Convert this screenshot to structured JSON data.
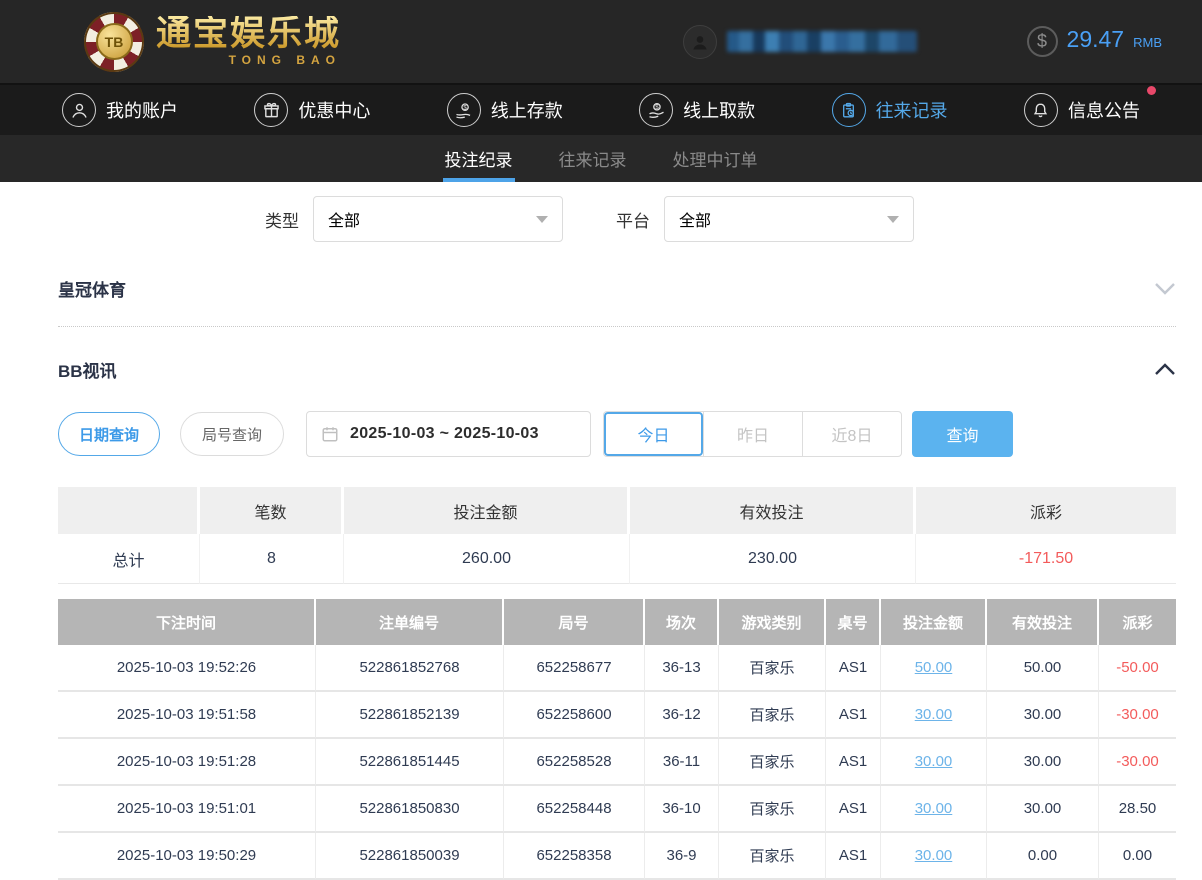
{
  "header": {
    "logo": {
      "chip_label": "TB",
      "title": "通宝娱乐城",
      "subtitle": "TONG BAO"
    },
    "balance": {
      "amount": "29.47",
      "currency": "RMB"
    }
  },
  "nav": {
    "items": [
      {
        "id": "my-account",
        "label": "我的账户",
        "icon": "user-icon",
        "active": false,
        "badge": false
      },
      {
        "id": "promo-center",
        "label": "优惠中心",
        "icon": "gift-icon",
        "active": false,
        "badge": false
      },
      {
        "id": "online-deposit",
        "label": "线上存款",
        "icon": "deposit-icon",
        "active": false,
        "badge": false
      },
      {
        "id": "online-withdraw",
        "label": "线上取款",
        "icon": "withdraw-icon",
        "active": false,
        "badge": false
      },
      {
        "id": "transaction-records",
        "label": "往来记录",
        "icon": "records-icon",
        "active": true,
        "badge": false
      },
      {
        "id": "announcements",
        "label": "信息公告",
        "icon": "bell-icon",
        "active": false,
        "badge": true
      }
    ]
  },
  "subnav": {
    "tabs": [
      {
        "id": "bet-records",
        "label": "投注纪录",
        "active": true
      },
      {
        "id": "transaction-records",
        "label": "往来记录",
        "active": false
      },
      {
        "id": "pending-orders",
        "label": "处理中订单",
        "active": false
      }
    ]
  },
  "filters": {
    "type_label": "类型",
    "type_value": "全部",
    "platform_label": "平台",
    "platform_value": "全部"
  },
  "sections": [
    {
      "id": "crown-sports",
      "title": "皇冠体育",
      "collapsed": true
    },
    {
      "id": "bb-live",
      "title": "BB视讯",
      "collapsed": false
    }
  ],
  "query": {
    "date_query": "日期查询",
    "round_query": "局号查询",
    "date_range": "2025-10-03 ~ 2025-10-03",
    "today": "今日",
    "yesterday": "昨日",
    "last8": "近8日",
    "search": "查询"
  },
  "summary": {
    "headers": [
      "",
      "笔数",
      "投注金额",
      "有效投注",
      "派彩"
    ],
    "row": [
      "总计",
      "8",
      "260.00",
      "230.00",
      "-171.50"
    ]
  },
  "table": {
    "headers": [
      "下注时间",
      "注单编号",
      "局号",
      "场次",
      "游戏类别",
      "桌号",
      "投注金额",
      "有效投注",
      "派彩"
    ],
    "rows": [
      [
        "2025-10-03 19:52:26",
        "522861852768",
        "652258677",
        "36-13",
        "百家乐",
        "AS1",
        "50.00",
        "50.00",
        "-50.00"
      ],
      [
        "2025-10-03 19:51:58",
        "522861852139",
        "652258600",
        "36-12",
        "百家乐",
        "AS1",
        "30.00",
        "30.00",
        "-30.00"
      ],
      [
        "2025-10-03 19:51:28",
        "522861851445",
        "652258528",
        "36-11",
        "百家乐",
        "AS1",
        "30.00",
        "30.00",
        "-30.00"
      ],
      [
        "2025-10-03 19:51:01",
        "522861850830",
        "652258448",
        "36-10",
        "百家乐",
        "AS1",
        "30.00",
        "30.00",
        "28.50"
      ],
      [
        "2025-10-03 19:50:29",
        "522861850039",
        "652258358",
        "36-9",
        "百家乐",
        "AS1",
        "30.00",
        "0.00",
        "0.00"
      ]
    ]
  },
  "colors": {
    "accent": "#54a8e8",
    "button_blue": "#5bb3ef",
    "negative_red": "#f35b5b",
    "link_blue": "#6db4e9",
    "balance_blue": "#4aa0f5",
    "gold": "#d4a440",
    "table_header_bg": "#b5b5b5",
    "badge_red": "#e8486a"
  }
}
